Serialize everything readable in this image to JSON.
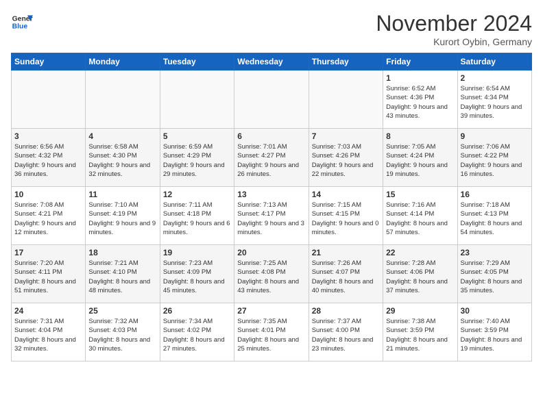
{
  "header": {
    "logo_line1": "General",
    "logo_line2": "Blue",
    "month": "November 2024",
    "location": "Kurort Oybin, Germany"
  },
  "weekdays": [
    "Sunday",
    "Monday",
    "Tuesday",
    "Wednesday",
    "Thursday",
    "Friday",
    "Saturday"
  ],
  "weeks": [
    [
      {
        "day": "",
        "info": ""
      },
      {
        "day": "",
        "info": ""
      },
      {
        "day": "",
        "info": ""
      },
      {
        "day": "",
        "info": ""
      },
      {
        "day": "",
        "info": ""
      },
      {
        "day": "1",
        "info": "Sunrise: 6:52 AM\nSunset: 4:36 PM\nDaylight: 9 hours and 43 minutes."
      },
      {
        "day": "2",
        "info": "Sunrise: 6:54 AM\nSunset: 4:34 PM\nDaylight: 9 hours and 39 minutes."
      }
    ],
    [
      {
        "day": "3",
        "info": "Sunrise: 6:56 AM\nSunset: 4:32 PM\nDaylight: 9 hours and 36 minutes."
      },
      {
        "day": "4",
        "info": "Sunrise: 6:58 AM\nSunset: 4:30 PM\nDaylight: 9 hours and 32 minutes."
      },
      {
        "day": "5",
        "info": "Sunrise: 6:59 AM\nSunset: 4:29 PM\nDaylight: 9 hours and 29 minutes."
      },
      {
        "day": "6",
        "info": "Sunrise: 7:01 AM\nSunset: 4:27 PM\nDaylight: 9 hours and 26 minutes."
      },
      {
        "day": "7",
        "info": "Sunrise: 7:03 AM\nSunset: 4:26 PM\nDaylight: 9 hours and 22 minutes."
      },
      {
        "day": "8",
        "info": "Sunrise: 7:05 AM\nSunset: 4:24 PM\nDaylight: 9 hours and 19 minutes."
      },
      {
        "day": "9",
        "info": "Sunrise: 7:06 AM\nSunset: 4:22 PM\nDaylight: 9 hours and 16 minutes."
      }
    ],
    [
      {
        "day": "10",
        "info": "Sunrise: 7:08 AM\nSunset: 4:21 PM\nDaylight: 9 hours and 12 minutes."
      },
      {
        "day": "11",
        "info": "Sunrise: 7:10 AM\nSunset: 4:19 PM\nDaylight: 9 hours and 9 minutes."
      },
      {
        "day": "12",
        "info": "Sunrise: 7:11 AM\nSunset: 4:18 PM\nDaylight: 9 hours and 6 minutes."
      },
      {
        "day": "13",
        "info": "Sunrise: 7:13 AM\nSunset: 4:17 PM\nDaylight: 9 hours and 3 minutes."
      },
      {
        "day": "14",
        "info": "Sunrise: 7:15 AM\nSunset: 4:15 PM\nDaylight: 9 hours and 0 minutes."
      },
      {
        "day": "15",
        "info": "Sunrise: 7:16 AM\nSunset: 4:14 PM\nDaylight: 8 hours and 57 minutes."
      },
      {
        "day": "16",
        "info": "Sunrise: 7:18 AM\nSunset: 4:13 PM\nDaylight: 8 hours and 54 minutes."
      }
    ],
    [
      {
        "day": "17",
        "info": "Sunrise: 7:20 AM\nSunset: 4:11 PM\nDaylight: 8 hours and 51 minutes."
      },
      {
        "day": "18",
        "info": "Sunrise: 7:21 AM\nSunset: 4:10 PM\nDaylight: 8 hours and 48 minutes."
      },
      {
        "day": "19",
        "info": "Sunrise: 7:23 AM\nSunset: 4:09 PM\nDaylight: 8 hours and 45 minutes."
      },
      {
        "day": "20",
        "info": "Sunrise: 7:25 AM\nSunset: 4:08 PM\nDaylight: 8 hours and 43 minutes."
      },
      {
        "day": "21",
        "info": "Sunrise: 7:26 AM\nSunset: 4:07 PM\nDaylight: 8 hours and 40 minutes."
      },
      {
        "day": "22",
        "info": "Sunrise: 7:28 AM\nSunset: 4:06 PM\nDaylight: 8 hours and 37 minutes."
      },
      {
        "day": "23",
        "info": "Sunrise: 7:29 AM\nSunset: 4:05 PM\nDaylight: 8 hours and 35 minutes."
      }
    ],
    [
      {
        "day": "24",
        "info": "Sunrise: 7:31 AM\nSunset: 4:04 PM\nDaylight: 8 hours and 32 minutes."
      },
      {
        "day": "25",
        "info": "Sunrise: 7:32 AM\nSunset: 4:03 PM\nDaylight: 8 hours and 30 minutes."
      },
      {
        "day": "26",
        "info": "Sunrise: 7:34 AM\nSunset: 4:02 PM\nDaylight: 8 hours and 27 minutes."
      },
      {
        "day": "27",
        "info": "Sunrise: 7:35 AM\nSunset: 4:01 PM\nDaylight: 8 hours and 25 minutes."
      },
      {
        "day": "28",
        "info": "Sunrise: 7:37 AM\nSunset: 4:00 PM\nDaylight: 8 hours and 23 minutes."
      },
      {
        "day": "29",
        "info": "Sunrise: 7:38 AM\nSunset: 3:59 PM\nDaylight: 8 hours and 21 minutes."
      },
      {
        "day": "30",
        "info": "Sunrise: 7:40 AM\nSunset: 3:59 PM\nDaylight: 8 hours and 19 minutes."
      }
    ]
  ]
}
